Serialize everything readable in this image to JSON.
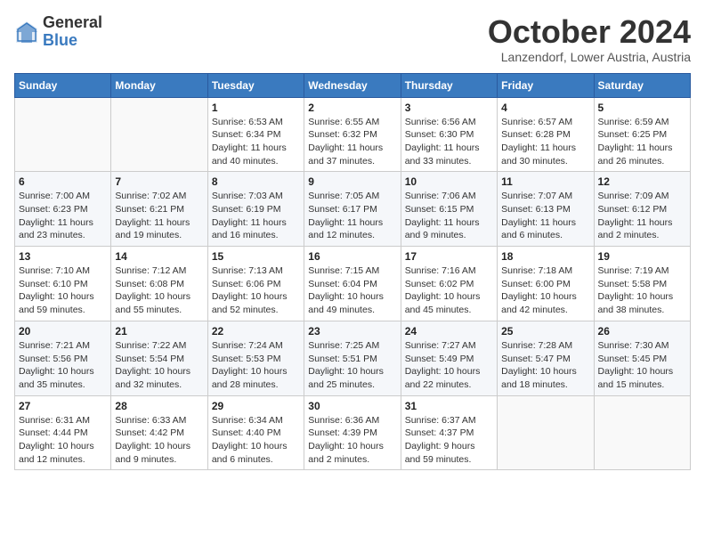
{
  "header": {
    "logo_general": "General",
    "logo_blue": "Blue",
    "month_title": "October 2024",
    "location": "Lanzendorf, Lower Austria, Austria"
  },
  "weekdays": [
    "Sunday",
    "Monday",
    "Tuesday",
    "Wednesday",
    "Thursday",
    "Friday",
    "Saturday"
  ],
  "weeks": [
    [
      {
        "day": "",
        "info": ""
      },
      {
        "day": "",
        "info": ""
      },
      {
        "day": "1",
        "info": "Sunrise: 6:53 AM\nSunset: 6:34 PM\nDaylight: 11 hours\nand 40 minutes."
      },
      {
        "day": "2",
        "info": "Sunrise: 6:55 AM\nSunset: 6:32 PM\nDaylight: 11 hours\nand 37 minutes."
      },
      {
        "day": "3",
        "info": "Sunrise: 6:56 AM\nSunset: 6:30 PM\nDaylight: 11 hours\nand 33 minutes."
      },
      {
        "day": "4",
        "info": "Sunrise: 6:57 AM\nSunset: 6:28 PM\nDaylight: 11 hours\nand 30 minutes."
      },
      {
        "day": "5",
        "info": "Sunrise: 6:59 AM\nSunset: 6:25 PM\nDaylight: 11 hours\nand 26 minutes."
      }
    ],
    [
      {
        "day": "6",
        "info": "Sunrise: 7:00 AM\nSunset: 6:23 PM\nDaylight: 11 hours\nand 23 minutes."
      },
      {
        "day": "7",
        "info": "Sunrise: 7:02 AM\nSunset: 6:21 PM\nDaylight: 11 hours\nand 19 minutes."
      },
      {
        "day": "8",
        "info": "Sunrise: 7:03 AM\nSunset: 6:19 PM\nDaylight: 11 hours\nand 16 minutes."
      },
      {
        "day": "9",
        "info": "Sunrise: 7:05 AM\nSunset: 6:17 PM\nDaylight: 11 hours\nand 12 minutes."
      },
      {
        "day": "10",
        "info": "Sunrise: 7:06 AM\nSunset: 6:15 PM\nDaylight: 11 hours\nand 9 minutes."
      },
      {
        "day": "11",
        "info": "Sunrise: 7:07 AM\nSunset: 6:13 PM\nDaylight: 11 hours\nand 6 minutes."
      },
      {
        "day": "12",
        "info": "Sunrise: 7:09 AM\nSunset: 6:12 PM\nDaylight: 11 hours\nand 2 minutes."
      }
    ],
    [
      {
        "day": "13",
        "info": "Sunrise: 7:10 AM\nSunset: 6:10 PM\nDaylight: 10 hours\nand 59 minutes."
      },
      {
        "day": "14",
        "info": "Sunrise: 7:12 AM\nSunset: 6:08 PM\nDaylight: 10 hours\nand 55 minutes."
      },
      {
        "day": "15",
        "info": "Sunrise: 7:13 AM\nSunset: 6:06 PM\nDaylight: 10 hours\nand 52 minutes."
      },
      {
        "day": "16",
        "info": "Sunrise: 7:15 AM\nSunset: 6:04 PM\nDaylight: 10 hours\nand 49 minutes."
      },
      {
        "day": "17",
        "info": "Sunrise: 7:16 AM\nSunset: 6:02 PM\nDaylight: 10 hours\nand 45 minutes."
      },
      {
        "day": "18",
        "info": "Sunrise: 7:18 AM\nSunset: 6:00 PM\nDaylight: 10 hours\nand 42 minutes."
      },
      {
        "day": "19",
        "info": "Sunrise: 7:19 AM\nSunset: 5:58 PM\nDaylight: 10 hours\nand 38 minutes."
      }
    ],
    [
      {
        "day": "20",
        "info": "Sunrise: 7:21 AM\nSunset: 5:56 PM\nDaylight: 10 hours\nand 35 minutes."
      },
      {
        "day": "21",
        "info": "Sunrise: 7:22 AM\nSunset: 5:54 PM\nDaylight: 10 hours\nand 32 minutes."
      },
      {
        "day": "22",
        "info": "Sunrise: 7:24 AM\nSunset: 5:53 PM\nDaylight: 10 hours\nand 28 minutes."
      },
      {
        "day": "23",
        "info": "Sunrise: 7:25 AM\nSunset: 5:51 PM\nDaylight: 10 hours\nand 25 minutes."
      },
      {
        "day": "24",
        "info": "Sunrise: 7:27 AM\nSunset: 5:49 PM\nDaylight: 10 hours\nand 22 minutes."
      },
      {
        "day": "25",
        "info": "Sunrise: 7:28 AM\nSunset: 5:47 PM\nDaylight: 10 hours\nand 18 minutes."
      },
      {
        "day": "26",
        "info": "Sunrise: 7:30 AM\nSunset: 5:45 PM\nDaylight: 10 hours\nand 15 minutes."
      }
    ],
    [
      {
        "day": "27",
        "info": "Sunrise: 6:31 AM\nSunset: 4:44 PM\nDaylight: 10 hours\nand 12 minutes."
      },
      {
        "day": "28",
        "info": "Sunrise: 6:33 AM\nSunset: 4:42 PM\nDaylight: 10 hours\nand 9 minutes."
      },
      {
        "day": "29",
        "info": "Sunrise: 6:34 AM\nSunset: 4:40 PM\nDaylight: 10 hours\nand 6 minutes."
      },
      {
        "day": "30",
        "info": "Sunrise: 6:36 AM\nSunset: 4:39 PM\nDaylight: 10 hours\nand 2 minutes."
      },
      {
        "day": "31",
        "info": "Sunrise: 6:37 AM\nSunset: 4:37 PM\nDaylight: 9 hours\nand 59 minutes."
      },
      {
        "day": "",
        "info": ""
      },
      {
        "day": "",
        "info": ""
      }
    ]
  ]
}
